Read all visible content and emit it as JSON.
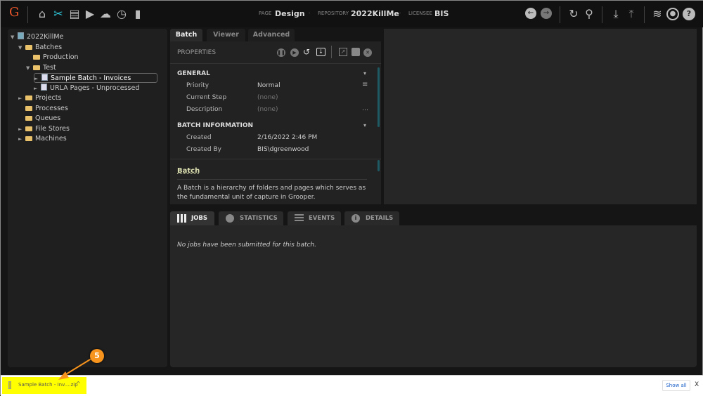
{
  "header": {
    "logo": "G",
    "page_label": "PAGE",
    "page_value": "Design",
    "repo_label": "REPOSITORY",
    "repo_value": "2022KillMe",
    "licensee_label": "LICENSEE",
    "licensee_value": "BIS",
    "sep": "·"
  },
  "tree": [
    {
      "label": "2022KillMe",
      "type": "root",
      "arrow": "▼"
    },
    {
      "label": "Batches",
      "type": "folder",
      "arrow": "▼"
    },
    {
      "label": "Production",
      "type": "folder",
      "arrow": ""
    },
    {
      "label": "Test",
      "type": "folder",
      "arrow": "▼"
    },
    {
      "label": "Sample Batch - Invoices",
      "type": "batch",
      "arrow": "►",
      "selected": true
    },
    {
      "label": "URLA Pages - Unprocessed",
      "type": "batch",
      "arrow": "►"
    },
    {
      "label": "Projects",
      "type": "folder",
      "arrow": "►"
    },
    {
      "label": "Processes",
      "type": "folder",
      "arrow": ""
    },
    {
      "label": "Queues",
      "type": "folder",
      "arrow": ""
    },
    {
      "label": "File Stores",
      "type": "folder",
      "arrow": "►"
    },
    {
      "label": "Machines",
      "type": "folder",
      "arrow": "►"
    }
  ],
  "tabs": [
    "Batch",
    "Viewer",
    "Advanced"
  ],
  "properties": {
    "title": "PROPERTIES",
    "general": {
      "title": "GENERAL",
      "rows": [
        {
          "label": "Priority",
          "value": "Normal"
        },
        {
          "label": "Current Step",
          "value": "(none)"
        },
        {
          "label": "Description",
          "value": "(none)"
        }
      ]
    },
    "info": {
      "title": "BATCH INFORMATION",
      "rows": [
        {
          "label": "Created",
          "value": "2/16/2022 2:46 PM"
        },
        {
          "label": "Created By",
          "value": "BIS\\dgreenwood"
        }
      ]
    },
    "help_title": "Batch",
    "help_text": "A Batch is a hierarchy of folders and pages which serves as the fundamental unit of capture in Grooper."
  },
  "bottom_tabs": [
    "JOBS",
    "STATISTICS",
    "EVENTS",
    "DETAILS"
  ],
  "jobs_empty": "No jobs have been submitted for this batch.",
  "download": {
    "file": "Sample Batch - Inv....zip",
    "show_all": "Show all",
    "close": "X"
  },
  "callout": "5",
  "colors": {
    "accent": "#2ec4d6",
    "callout": "#f7941d",
    "highlight": "#ffff00"
  }
}
